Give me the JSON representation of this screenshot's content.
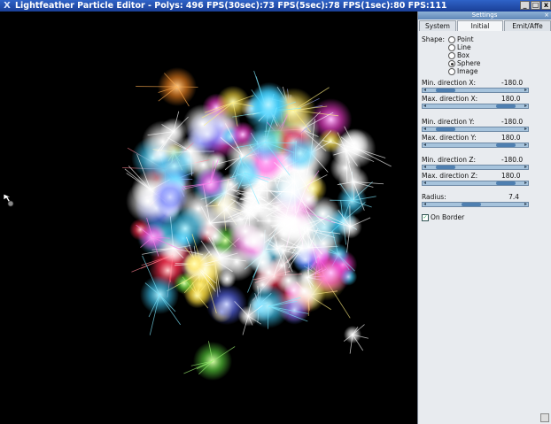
{
  "window": {
    "title": "Lightfeather Particle Editor - Polys: 496 FPS(30sec):73 FPS(5sec):78 FPS(1sec):80 FPS:111",
    "app_icon": "X",
    "buttons": [
      "_",
      "□",
      "x"
    ]
  },
  "settings_panel": {
    "title": "Settings",
    "tabs": [
      {
        "label": "System",
        "active": false
      },
      {
        "label": "Initial",
        "active": true
      },
      {
        "label": "Emit/Affe",
        "active": false
      }
    ],
    "shape": {
      "label": "Shape:",
      "options": [
        {
          "label": "Point",
          "selected": false
        },
        {
          "label": "Line",
          "selected": false
        },
        {
          "label": "Box",
          "selected": false
        },
        {
          "label": "Sphere",
          "selected": true
        },
        {
          "label": "Image",
          "selected": false
        }
      ]
    },
    "fields": [
      {
        "label": "Min. direction X:",
        "value": "-180.0",
        "fraction": 0.1
      },
      {
        "label": "Max. direction X:",
        "value": "180.0",
        "fraction": 0.9
      },
      {
        "label": "Min. direction Y:",
        "value": "-180.0",
        "fraction": 0.1
      },
      {
        "label": "Max. direction Y:",
        "value": "180.0",
        "fraction": 0.9
      },
      {
        "label": "Min. direction Z:",
        "value": "-180.0",
        "fraction": 0.1
      },
      {
        "label": "Max. direction Z:",
        "value": "180.0",
        "fraction": 0.9
      },
      {
        "label": "Radius:",
        "value": "7.4",
        "fraction": 0.45
      }
    ],
    "on_border": {
      "label": "On Border",
      "checked": true
    }
  },
  "colors": {
    "titlebar": "#2f63c8",
    "viewport_bg": "#000000",
    "panel_bg": "#e8ebef",
    "slider": "#a6c3dc"
  }
}
